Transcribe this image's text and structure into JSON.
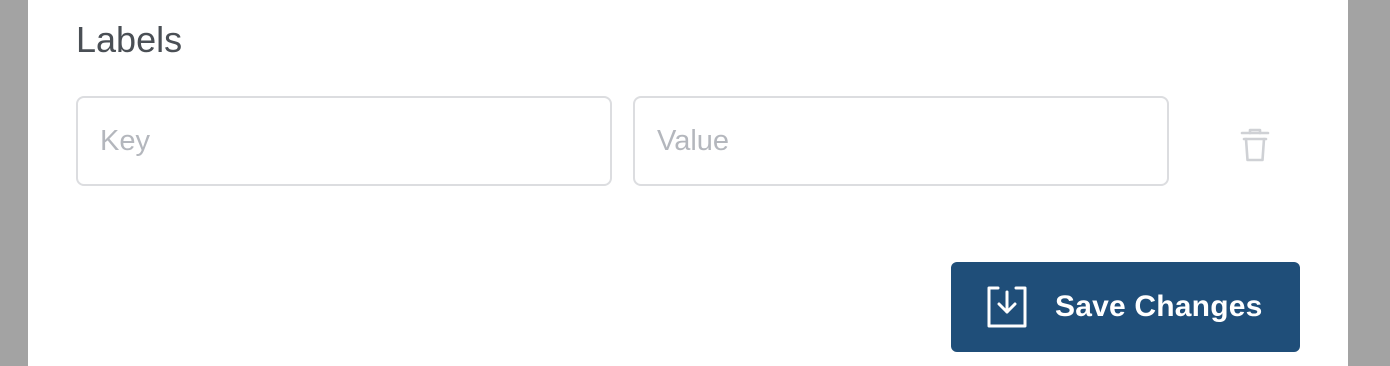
{
  "labels_section": {
    "title": "Labels",
    "key_input": {
      "placeholder": "Key",
      "value": ""
    },
    "value_input": {
      "placeholder": "Value",
      "value": ""
    },
    "delete_icon": "trash-icon"
  },
  "actions": {
    "save_label": "Save Changes",
    "save_icon": "save-download-icon",
    "save_color": "#1f4e79"
  }
}
